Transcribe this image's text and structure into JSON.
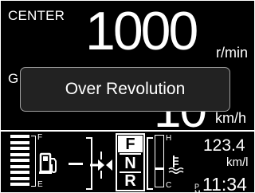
{
  "header": {
    "mode_label": "CENTER",
    "rpm_value": "1000",
    "rpm_unit": "r/min"
  },
  "speed": {
    "label_partial": "G",
    "value": "10",
    "unit": "km/h"
  },
  "popup": {
    "message": "Over Revolution"
  },
  "fuel": {
    "full_label": "F",
    "empty_label": "E",
    "bars_total": 9,
    "bars_lit": 9,
    "icon": "fuel-pump-icon"
  },
  "transmission": {
    "gears": [
      "F",
      "N",
      "R"
    ],
    "selected": "F"
  },
  "temperature": {
    "hot_label": "H",
    "cold_label": "C",
    "icon": "coolant-temp-icon"
  },
  "odometer": {
    "value": "123.4",
    "unit": "km/l"
  },
  "clock": {
    "am_label": "A",
    "pm_label": "P",
    "meridiem_marker": "M",
    "time": "11:34"
  }
}
